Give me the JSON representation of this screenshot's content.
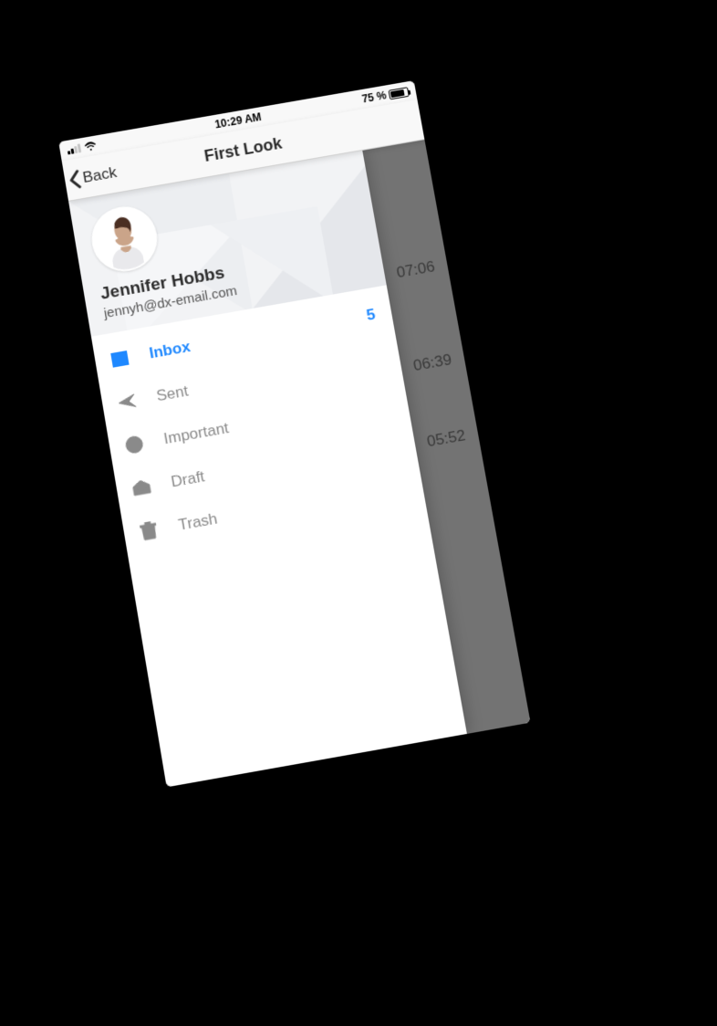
{
  "status": {
    "time": "10:29 AM",
    "battery_pct": "75 %"
  },
  "nav": {
    "back_label": "Back",
    "title": "First Look"
  },
  "profile": {
    "name": "Jennifer Hobbs",
    "email": "jennyh@dx-email.com"
  },
  "menu": {
    "items": [
      {
        "label": "Inbox",
        "icon": "inbox-icon",
        "badge": "5",
        "active": true
      },
      {
        "label": "Sent",
        "icon": "send-icon",
        "badge": "",
        "active": false
      },
      {
        "label": "Important",
        "icon": "important-icon",
        "badge": "",
        "active": false
      },
      {
        "label": "Draft",
        "icon": "draft-icon",
        "badge": "",
        "active": false
      },
      {
        "label": "Trash",
        "icon": "trash-icon",
        "badge": "",
        "active": false
      }
    ]
  },
  "underlay": {
    "times": [
      "07:06",
      "06:39",
      "05:52"
    ]
  }
}
